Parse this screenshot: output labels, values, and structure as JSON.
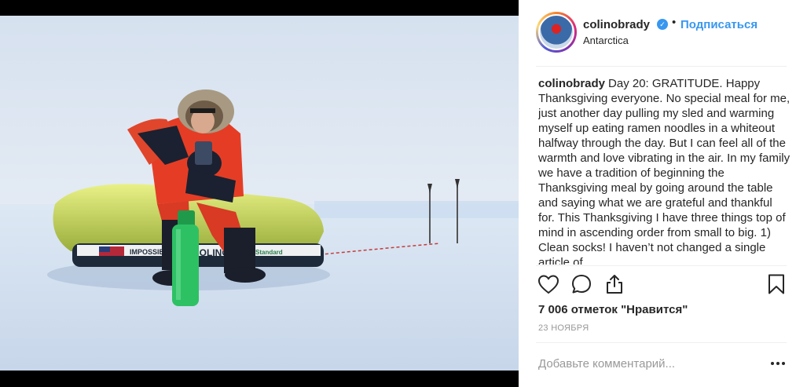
{
  "post": {
    "username": "colinobrady",
    "follow_label": "Подписаться",
    "location": "Antarctica",
    "caption_user": "colinobrady",
    "caption_text": "Day 20: GRATITUDE. Happy Thanksgiving everyone. No special meal for me, just another day pulling my sled and warming myself up eating ramen noodles in a whiteout halfway through the day. But I can feel all of the warmth and love vibrating in the air. In my family we have a tradition of beginning the Thanksgiving meal by going around the table and saying what we are grateful and thankful for. This Thanksgiving I have three things top of mind in ascending order from small to big. 1) Clean socks! I haven’t not changed a single article of",
    "likes": "7 006 отметок \"Нравится\"",
    "date": "23 НОЯБРЯ",
    "comment_placeholder": "Добавьте комментарий..."
  },
  "photo": {
    "sled_text_left": "IMPOSSIBLE",
    "sled_text_mid": "COLINOB",
    "sled_text_right": "Standard"
  },
  "icons": {
    "verified": "verified-badge-icon",
    "like": "heart-icon",
    "comment": "comment-bubble-icon",
    "share": "share-icon",
    "save": "bookmark-icon",
    "more": "more-options-icon"
  },
  "colors": {
    "accent": "#3897f0",
    "text": "#262626",
    "muted": "#999999"
  }
}
